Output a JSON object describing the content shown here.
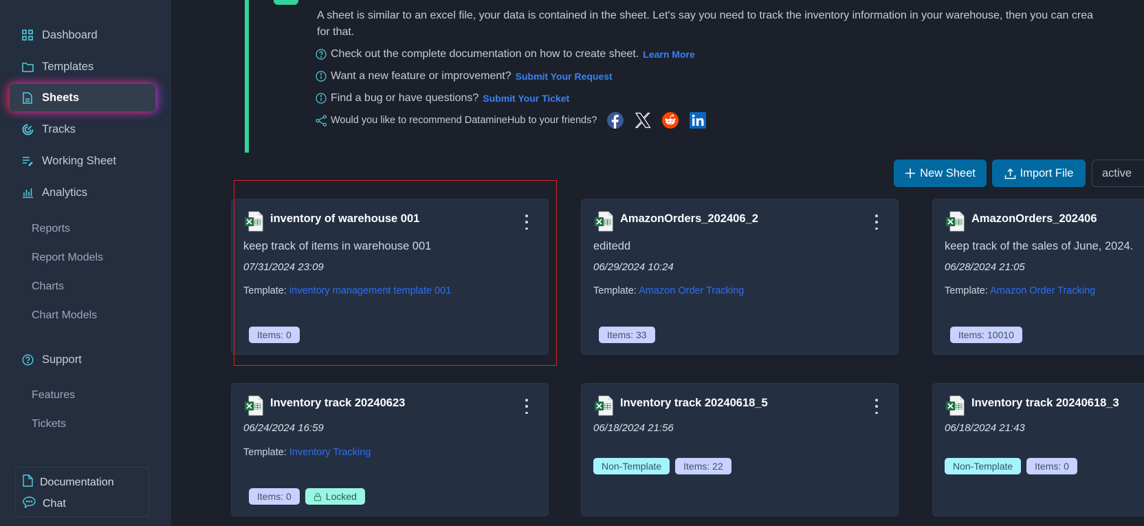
{
  "sidebar": {
    "items": [
      {
        "label": "Dashboard",
        "icon": "grid-icon"
      },
      {
        "label": "Templates",
        "icon": "folder-icon"
      },
      {
        "label": "Sheets",
        "icon": "document-icon",
        "active": true
      },
      {
        "label": "Tracks",
        "icon": "radar-icon"
      },
      {
        "label": "Working Sheet",
        "icon": "list-edit-icon"
      },
      {
        "label": "Analytics",
        "icon": "bar-chart-icon"
      }
    ],
    "analytics_sub": [
      "Reports",
      "Report Models",
      "Charts",
      "Chart Models"
    ],
    "support": {
      "label": "Support",
      "icon": "question-circle-icon"
    },
    "support_sub": [
      "Features",
      "Tickets"
    ],
    "footer": [
      {
        "label": "Documentation",
        "icon": "file-icon"
      },
      {
        "label": "Chat",
        "icon": "chat-bubble-icon"
      }
    ]
  },
  "info": {
    "description_line1": "A sheet is similar to an excel file, your data is contained in the sheet. Let's say you need to track the inventory information in your warehouse, then you can crea",
    "description_line2": "for that.",
    "lines": [
      {
        "text": "Check out the complete documentation on how to create sheet.",
        "link": "Learn More",
        "icon": "question-circle-icon"
      },
      {
        "text": "Want a new feature or improvement?",
        "link": "Submit Your Request",
        "icon": "info-circle-icon"
      },
      {
        "text": "Find a bug or have questions?",
        "link": "Submit Your Ticket",
        "icon": "info-circle-icon"
      }
    ],
    "share_text": "Would you like to recommend DatamineHub to your friends?",
    "social": [
      "facebook",
      "x",
      "reddit",
      "linkedin"
    ]
  },
  "toolbar": {
    "new_sheet": "New Sheet",
    "import_file": "Import File",
    "status_filter": "active"
  },
  "colors": {
    "accent_green": "#34d399",
    "button_blue": "#0369a1",
    "link_blue": "#2f6df0"
  },
  "sheets": [
    {
      "title": "inventory of warehouse 001",
      "description": "keep track of items in warehouse 001",
      "date": "07/31/2024 23:09",
      "template_label": "Template:",
      "template": "inventory management template 001",
      "badges": [
        "Items: 0"
      ]
    },
    {
      "title": "AmazonOrders_202406_2",
      "description": "editedd",
      "date": "06/29/2024 10:24",
      "template_label": "Template:",
      "template": "Amazon Order Tracking",
      "badges": [
        "Items: 33"
      ]
    },
    {
      "title": "AmazonOrders_202406",
      "description": "keep track of the sales of June, 2024.",
      "date": "06/28/2024 21:05",
      "template_label": "Template:",
      "template": "Amazon Order Tracking",
      "badges": [
        "Items: 10010"
      ]
    },
    {
      "title": "Inventory track 20240623",
      "date": "06/24/2024 16:59",
      "template_label": "Template:",
      "template": "Inventory Tracking",
      "badges": [
        "Items: 0",
        "Locked"
      ]
    },
    {
      "title": "Inventory track 20240618_5",
      "date": "06/18/2024 21:56",
      "badges": [
        "Non-Template",
        "Items: 22"
      ]
    },
    {
      "title": "Inventory track 20240618_3",
      "date": "06/18/2024 21:43",
      "badges": [
        "Non-Template",
        "Items: 0"
      ]
    }
  ]
}
